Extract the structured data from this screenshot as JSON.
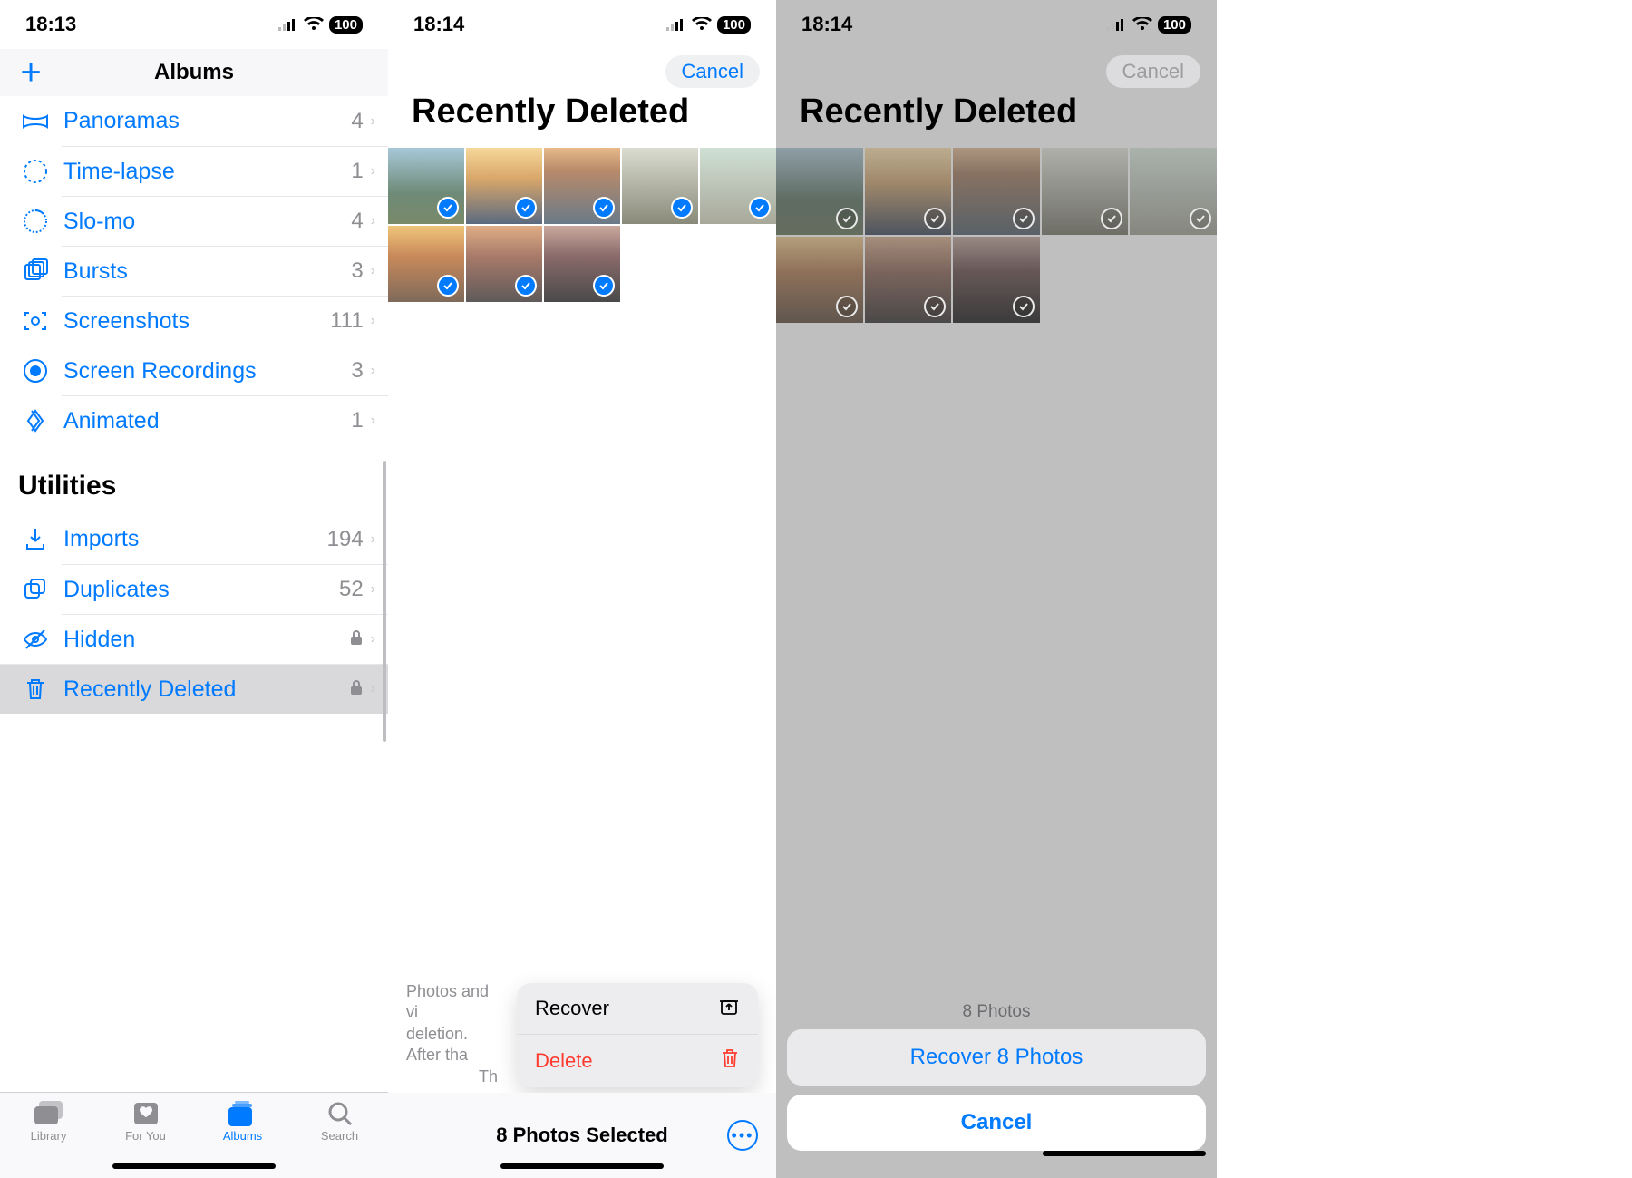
{
  "p1": {
    "status": {
      "time": "18:13",
      "battery": "100"
    },
    "nav": {
      "title": "Albums"
    },
    "media_types": [
      {
        "icon": "panorama-icon",
        "label": "Panoramas",
        "count": "4"
      },
      {
        "icon": "timelapse-icon",
        "label": "Time-lapse",
        "count": "1"
      },
      {
        "icon": "slomo-icon",
        "label": "Slo-mo",
        "count": "4"
      },
      {
        "icon": "bursts-icon",
        "label": "Bursts",
        "count": "3"
      },
      {
        "icon": "screenshots-icon",
        "label": "Screenshots",
        "count": "111"
      },
      {
        "icon": "screenrecordings-icon",
        "label": "Screen Recordings",
        "count": "3"
      },
      {
        "icon": "animated-icon",
        "label": "Animated",
        "count": "1"
      }
    ],
    "utilities_header": "Utilities",
    "utilities": [
      {
        "icon": "imports-icon",
        "label": "Imports",
        "count": "194",
        "locked": false
      },
      {
        "icon": "duplicates-icon",
        "label": "Duplicates",
        "count": "52",
        "locked": false
      },
      {
        "icon": "hidden-icon",
        "label": "Hidden",
        "count": "",
        "locked": true
      },
      {
        "icon": "recentlydeleted-icon",
        "label": "Recently Deleted",
        "count": "",
        "locked": true,
        "selected": true
      }
    ],
    "tabs": [
      {
        "icon": "library-tab-icon",
        "label": "Library"
      },
      {
        "icon": "foryou-tab-icon",
        "label": "For You"
      },
      {
        "icon": "albums-tab-icon",
        "label": "Albums"
      },
      {
        "icon": "search-tab-icon",
        "label": "Search"
      }
    ],
    "active_tab": "Albums"
  },
  "p2": {
    "status": {
      "time": "18:14",
      "battery": "100"
    },
    "cancel": "Cancel",
    "title": "Recently Deleted",
    "hint_line1": "Photos and vi",
    "hint_line2": "deletion. After tha",
    "hint_line3": "Th",
    "menu": {
      "recover": "Recover",
      "delete": "Delete"
    },
    "bottom": "8 Photos Selected"
  },
  "p3": {
    "status": {
      "time": "18:14",
      "battery": "100"
    },
    "cancel": "Cancel",
    "title": "Recently Deleted",
    "sheet": {
      "headline": "8 Photos",
      "recover": "Recover 8 Photos",
      "cancel": "Cancel"
    }
  }
}
